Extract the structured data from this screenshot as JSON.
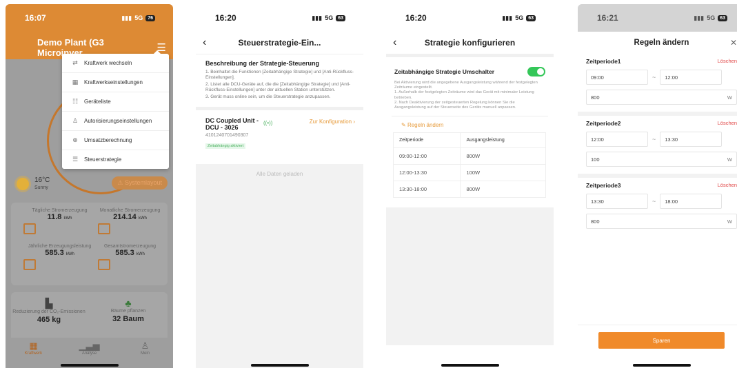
{
  "p1": {
    "time": "16:07",
    "signal": "5G",
    "battery": "76",
    "plant_title": "Demo Plant (G3 Microinver...",
    "menu": [
      {
        "icon": "⇄",
        "label": "Kraftwerk wechseln"
      },
      {
        "icon": "▦",
        "label": "Kraftwerkseinstellungen"
      },
      {
        "icon": "☷",
        "label": "Geräteliste"
      },
      {
        "icon": "♙",
        "label": "Autorisierungseinstellungen"
      },
      {
        "icon": "⊕",
        "label": "Umsatzberechnung"
      },
      {
        "icon": "☰",
        "label": "Steuerstrategie"
      }
    ],
    "temperature": "16°C",
    "weather_label": "Sunny",
    "system_layout": "Systemlayout",
    "stats": {
      "daily_label": "Tägliche Stromerzeugung",
      "daily_value": "11.8",
      "daily_unit": "kWh",
      "monthly_label": "Monatliche Stromerzeugung",
      "monthly_value": "214.14",
      "monthly_unit": "kWh",
      "yearly_label": "Jährliche Erzeugungsleistung",
      "yearly_value": "585.3",
      "yearly_unit": "kWh",
      "total_label": "Gesamtstromerzeugung",
      "total_value": "585.3",
      "total_unit": "kWh"
    },
    "eco": {
      "co2_label": "Reduzierung der CO₂-Emissionen",
      "co2_value": "465 kg",
      "trees_label": "Bäume pflanzen",
      "trees_value": "32 Baum"
    },
    "tabs": [
      "Kraftwerk",
      "Analyse",
      "Mein"
    ]
  },
  "p2": {
    "time": "16:20",
    "signal": "5G",
    "battery": "63",
    "title": "Steuerstrategie-Ein...",
    "desc_title": "Beschreibung der Strategie-Steuerung",
    "desc_lines": [
      "1. Beinhaltet die Funktionen [Zeitabhängige Strategie] und [Anti-Rückfluss-Einstellungen].",
      "2. Listet alle DCU-Geräte auf, die die [Zeitabhängige Strategie] und [Anti-Rückfluss-Einstellungen] unter der aktuellen Station unterstützen.",
      "3. Gerät muss online sein, um die Steuerstrategie anzupassen."
    ],
    "unit_name": "DC Coupled Unit - DCU - 3026",
    "unit_sn": "4101240701490307",
    "unit_badge": "Zeitabhängig aktiviert",
    "unit_config": "Zur Konfiguration ›",
    "all_loaded": "Alle Daten geladen"
  },
  "p3": {
    "time": "16:20",
    "signal": "5G",
    "battery": "63",
    "title": "Strategie konfigurieren",
    "toggle_label": "Zeitabhängige Strategie Umschalter",
    "toggle_desc": [
      "Bei Aktivierung wird die angegebene Ausgangsleistung während der festgelegten Zeiträume eingestellt.",
      "1. Außerhalb der festgelegten Zeiträume wird das Gerät mit minimaler Leistung betrieben.",
      "2. Nach Deaktivierung der zeitgesteuerten Regelung können Sie die Ausgangsleistung auf der Steuerseite des Geräts manuell anpassen."
    ],
    "edit_rules": "Regeln ändern",
    "columns": [
      "Zeitperiode",
      "Ausgangsleistung"
    ],
    "rows": [
      [
        "09:00-12:00",
        "800W"
      ],
      [
        "12:00-13:30",
        "100W"
      ],
      [
        "13:30-18:00",
        "800W"
      ]
    ]
  },
  "p4": {
    "time": "16:21",
    "signal": "5G",
    "battery": "63",
    "title": "Regeln ändern",
    "delete_label": "Löschen",
    "unit": "W",
    "periods": [
      {
        "name": "Zeitperiode1",
        "start": "09:00",
        "end": "12:00",
        "power": "800"
      },
      {
        "name": "Zeitperiode2",
        "start": "12:00",
        "end": "13:30",
        "power": "100"
      },
      {
        "name": "Zeitperiode3",
        "start": "13:30",
        "end": "18:00",
        "power": "800"
      }
    ],
    "save": "Sparen"
  },
  "colors": {
    "accent": "#f08a2a",
    "header": "#dd8a34",
    "toggle": "#34c759",
    "delete": "#e04545",
    "link": "#e69a3a"
  }
}
